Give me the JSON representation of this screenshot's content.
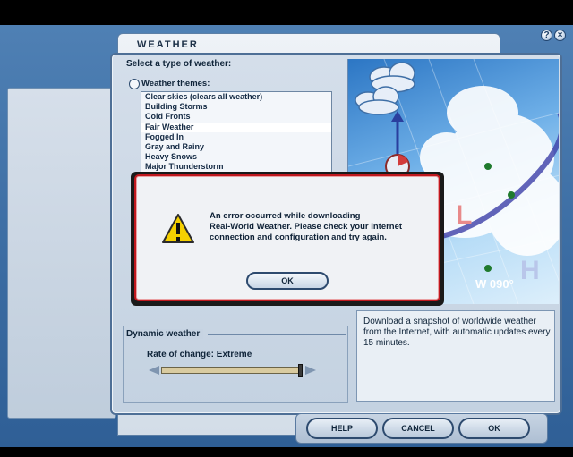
{
  "window": {
    "title": "WEATHER",
    "help_glyph": "?",
    "close_glyph": "×"
  },
  "weather_select": {
    "heading": "Select a type of weather:",
    "themes_label": "Weather themes:",
    "themes": [
      "Clear skies (clears all weather)",
      "Building Storms",
      "Cold Fronts",
      "Fair Weather",
      "Fogged In",
      "Gray and Rainy",
      "Heavy Snows",
      "Major Thunderstorm"
    ],
    "selected_theme": "Fair Weather"
  },
  "dynamic": {
    "heading": "Dynamic weather",
    "rate_label": "Rate of change: Extreme",
    "rate_fraction": 1.0
  },
  "info": {
    "text": "Download a snapshot of worldwide weather from the Internet, with automatic updates every 15 minutes."
  },
  "image": {
    "wind_label": "W 090°",
    "low_label": "L",
    "high_label": "H"
  },
  "buttons": {
    "help": "HELP",
    "cancel": "CANCEL",
    "ok": "OK"
  },
  "error_dialog": {
    "message_line1": "An error occurred while downloading",
    "message_line2": "Real-World Weather. Please check your Internet",
    "message_line3": "connection and configuration and try again.",
    "ok_label": "OK",
    "icon": "warning-icon"
  },
  "colors": {
    "dialog_border": "#c0181e",
    "warning_fill": "#f5d000",
    "panel_border": "#4e6f96"
  }
}
